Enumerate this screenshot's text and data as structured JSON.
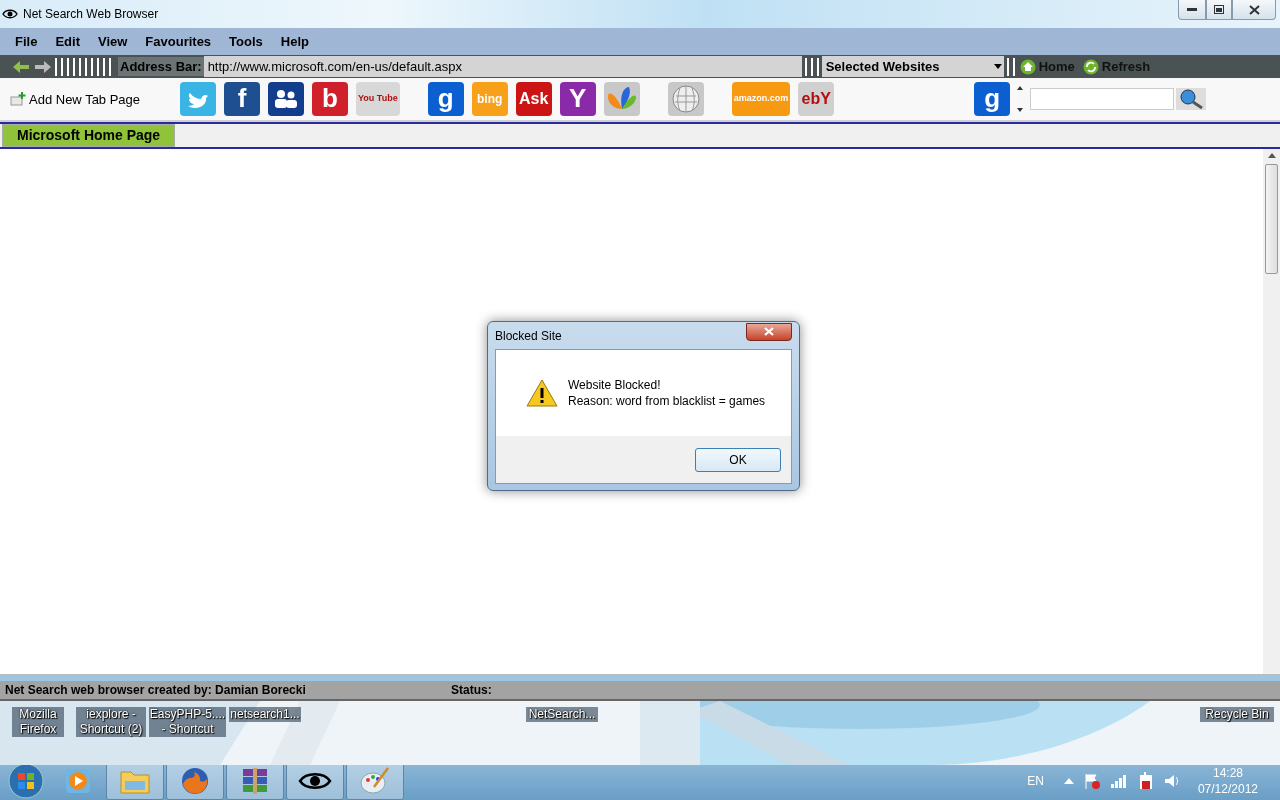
{
  "window": {
    "title": "Net Search Web Browser"
  },
  "menu": [
    "File",
    "Edit",
    "View",
    "Favourites",
    "Tools",
    "Help"
  ],
  "address_bar": {
    "label": "Address Bar:",
    "value": "http://www.microsoft.com/en-us/default.aspx"
  },
  "site_list": {
    "value": "Selected Websites"
  },
  "nav_buttons": [
    "Home",
    "Refresh"
  ],
  "add_tab": "Add New Tab Page",
  "site_groups": [
    [
      {
        "kind": "bird",
        "color": "#3ab4e4"
      },
      {
        "kind": "text",
        "text": "f",
        "color": "#1d4f91"
      },
      {
        "kind": "people",
        "color": "#123d8c"
      },
      {
        "kind": "text",
        "text": "b",
        "color": "#d0202a"
      },
      {
        "kind": "text",
        "text": "You Tube",
        "color": "#d8d8d8"
      }
    ],
    [
      {
        "kind": "text",
        "text": "g",
        "color": "#0b5fd1"
      },
      {
        "kind": "text",
        "text": "bing",
        "color": "#f7a11a"
      },
      {
        "kind": "text",
        "text": "Ask",
        "color": "#cc1414"
      },
      {
        "kind": "text",
        "text": "Y",
        "color": "#8b2aa8"
      },
      {
        "kind": "butterfly",
        "color": "#c8c8c8"
      }
    ],
    [
      {
        "kind": "globe",
        "color": "#c8c8c8"
      }
    ],
    [
      {
        "kind": "text",
        "text": "amazon.com",
        "color": "#f79a12"
      },
      {
        "kind": "text",
        "text": "ebY",
        "color": "#d0d0d0"
      }
    ]
  ],
  "search": {
    "logo": "g"
  },
  "tabs": [
    {
      "label": "Microsoft Home Page",
      "selected": true
    }
  ],
  "dialog": {
    "title": "Blocked Site",
    "message": "Website Blocked!",
    "reason": "Reason: word from blacklist = games",
    "button": "OK"
  },
  "status_bar": {
    "credit": "Net Search web browser created by: Damian Borecki",
    "status_label": "Status:"
  },
  "desktop_icons": [
    {
      "label": "Mozilla Firefox"
    },
    {
      "label": "iexplore - Shortcut (2)"
    },
    {
      "label": "EasyPHP-5.... - Shortcut"
    },
    {
      "label": "netsearch1..."
    },
    {
      "label": "NetSearch..."
    },
    {
      "label": "Recycle Bin"
    }
  ],
  "taskbar": {
    "apps": [
      {
        "kind": "folder"
      },
      {
        "kind": "fox"
      },
      {
        "kind": "books"
      },
      {
        "kind": "eye"
      },
      {
        "kind": "palette"
      }
    ],
    "language": "EN",
    "time": "14:28",
    "date": "07/12/2012"
  }
}
